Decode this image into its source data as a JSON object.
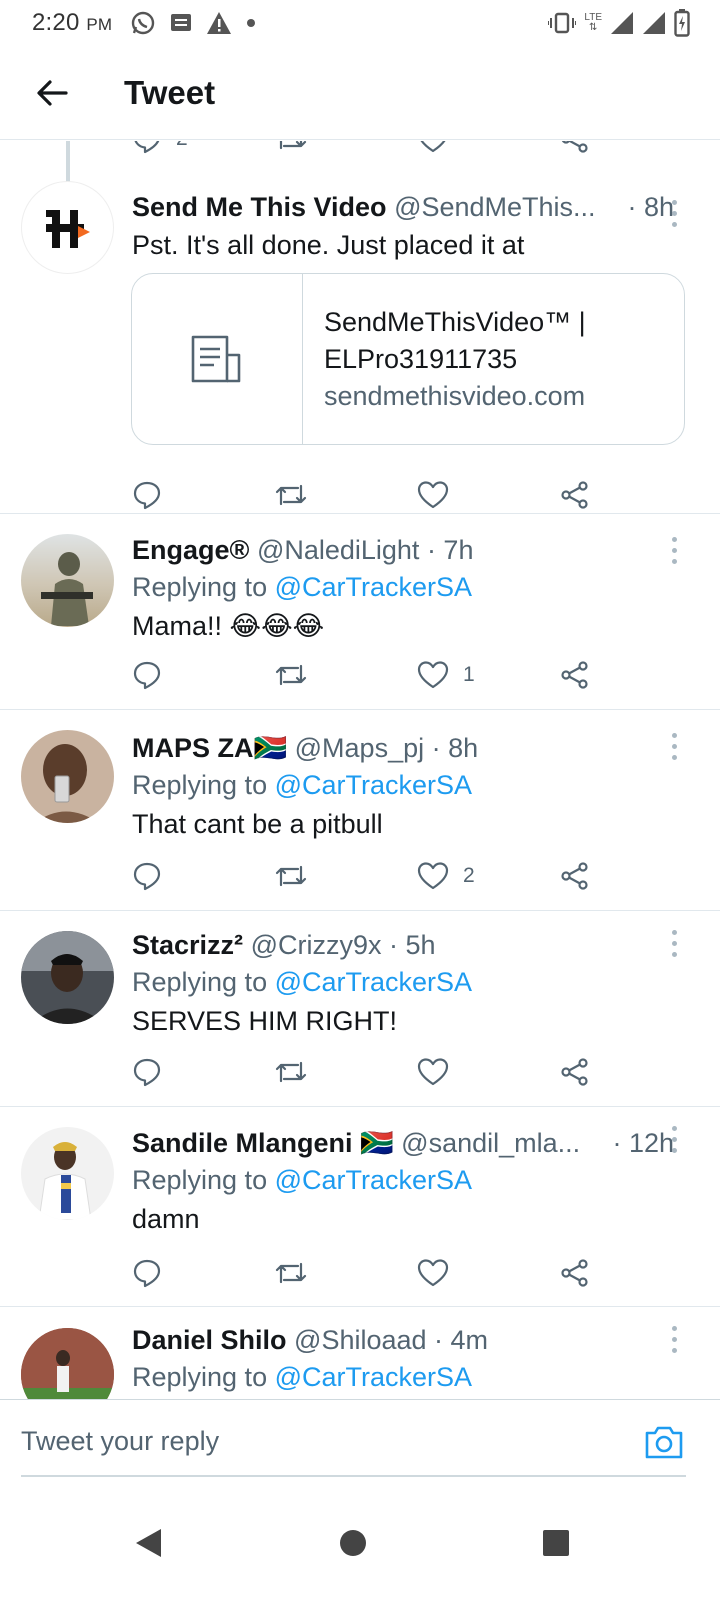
{
  "status_bar": {
    "time": "2:20",
    "ampm": "PM",
    "network": "LTE"
  },
  "header": {
    "title": "Tweet"
  },
  "partial_actions": {
    "reply_count": "2"
  },
  "tweets": [
    {
      "name": "Send Me This Video",
      "handle": "@SendMeThis...",
      "time": "· 8h",
      "text": "Pst. It's all done. Just placed it at",
      "card": {
        "title_line1": "SendMeThisVideo™ |",
        "title_line2": "ELPro31911735",
        "domain": "sendmethisvideo.com"
      },
      "likes": ""
    },
    {
      "name": "Engage®",
      "handle": "@NalediLight · 7h",
      "replying_label": "Replying to",
      "replying_to": "@CarTrackerSA",
      "text": "Mama!! 😂😂😂",
      "likes": "1"
    },
    {
      "name": "MAPS ZA🇿🇦",
      "handle": "@Maps_pj · 8h",
      "replying_label": "Replying to",
      "replying_to": "@CarTrackerSA",
      "text": "That cant be a pitbull",
      "likes": "2"
    },
    {
      "name": "Stacrizz²",
      "handle": "@Crizzy9x · 5h",
      "replying_label": "Replying to",
      "replying_to": "@CarTrackerSA",
      "text": "SERVES HIM RIGHT!",
      "likes": ""
    },
    {
      "name": "Sandile Mlangeni 🇿🇦",
      "handle": "@sandil_mla...",
      "time": "· 12h",
      "replying_label": "Replying to",
      "replying_to": "@CarTrackerSA",
      "text": "damn",
      "likes": ""
    },
    {
      "name": "Daniel Shilo",
      "handle": "@Shiloaad · 4m",
      "replying_label": "Replying to",
      "replying_to": "@CarTrackerSA"
    }
  ],
  "reply_bar": {
    "placeholder": "Tweet your reply"
  },
  "colors": {
    "accent": "#1d9bf0",
    "secondary_text": "#536471",
    "divider": "#e1e8ed"
  }
}
